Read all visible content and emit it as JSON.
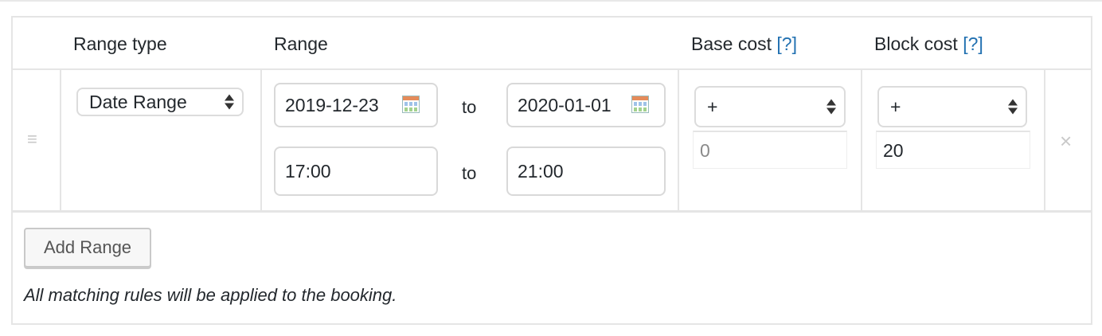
{
  "table": {
    "headers": {
      "range_type": "Range type",
      "range": "Range",
      "base_cost": "Base cost",
      "block_cost": "Block cost",
      "help_marker": "[?]"
    },
    "row": {
      "drag_handle_icon": "≡",
      "range_type_value": "Date Range",
      "date_from": "2019-12-23",
      "date_to": "2020-01-01",
      "time_from": "17:00",
      "time_to": "21:00",
      "to_label": "to",
      "base_modifier": "+",
      "base_cost_value": "0",
      "block_modifier": "+",
      "block_cost_value": "20",
      "remove_icon": "×"
    }
  },
  "footer": {
    "add_range_label": "Add Range",
    "note": "All matching rules will be applied to the booking."
  },
  "colors": {
    "help_link": "#2271b1",
    "border": "#e5e5e5",
    "text": "#23282d"
  }
}
